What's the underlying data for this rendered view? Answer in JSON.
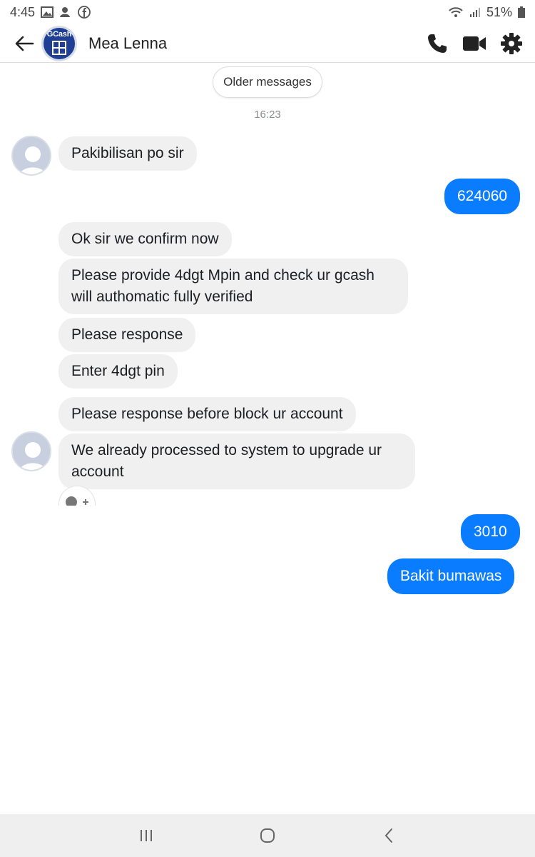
{
  "status_bar": {
    "time": "4:45",
    "battery": "51%",
    "icons": [
      "gallery-icon",
      "person-notification-icon",
      "facebook-icon",
      "wifi-icon",
      "signal-icon",
      "battery-icon"
    ]
  },
  "header": {
    "contact_name": "Mea Lenna",
    "avatar_brand": "GCash",
    "icons": [
      "back-arrow-icon",
      "phone-icon",
      "video-camera-icon",
      "gear-icon"
    ]
  },
  "conversation": {
    "older_messages_label": "Older messages",
    "timestamp": "16:23",
    "messages": [
      {
        "direction": "incoming",
        "text": "Pakibilisan po sir"
      },
      {
        "direction": "outgoing",
        "text": "624060"
      },
      {
        "direction": "incoming",
        "text": "Ok sir we confirm now"
      },
      {
        "direction": "incoming",
        "text": "Please provide 4dgt Mpin and check ur gcash will authomatic fully verified"
      },
      {
        "direction": "incoming",
        "text": "Please response"
      },
      {
        "direction": "incoming",
        "text": "Enter 4dgt pin"
      },
      {
        "direction": "incoming",
        "text": "Please response before block ur account"
      },
      {
        "direction": "incoming",
        "text": "We already processed to system to upgrade ur account"
      },
      {
        "direction": "outgoing",
        "text": "3010"
      },
      {
        "direction": "outgoing",
        "text": "Bakit bumawas"
      }
    ]
  },
  "colors": {
    "outgoing_bubble": "#0a7cff",
    "incoming_bubble": "#f0f0f0",
    "text_on_outgoing": "#ffffff"
  },
  "nav_bar": {
    "icons": [
      "recent-apps-icon",
      "home-icon",
      "back-icon"
    ]
  }
}
